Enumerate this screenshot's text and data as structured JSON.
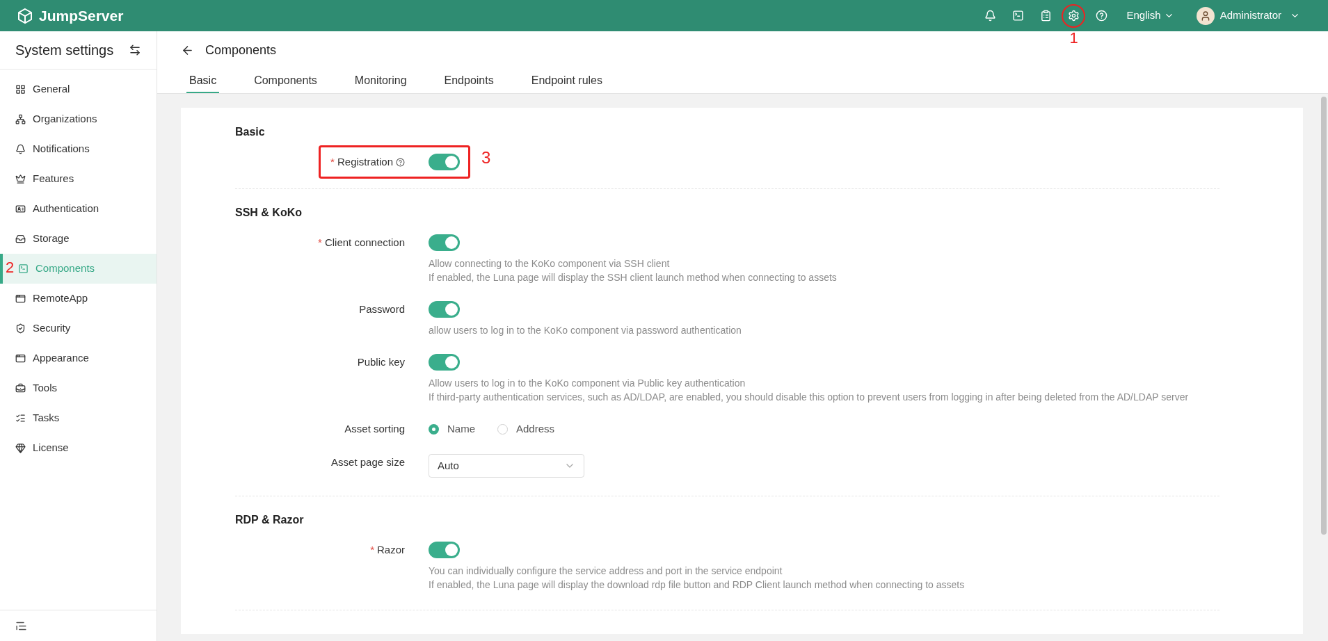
{
  "header": {
    "brand": "JumpServer",
    "icons": [
      {
        "kind": "bell"
      },
      {
        "kind": "terminal"
      },
      {
        "kind": "clipboard"
      },
      {
        "kind": "settings",
        "annotation": "1"
      },
      {
        "kind": "help"
      }
    ],
    "language": "English",
    "user": "Administrator"
  },
  "sidebar": {
    "title": "System settings",
    "items": [
      {
        "label": "General",
        "selected": false
      },
      {
        "label": "Organizations",
        "selected": false
      },
      {
        "label": "Notifications",
        "selected": false
      },
      {
        "label": "Features",
        "selected": false
      },
      {
        "label": "Authentication",
        "selected": false
      },
      {
        "label": "Storage",
        "selected": false
      },
      {
        "label": "Components",
        "selected": true,
        "annotation": "2"
      },
      {
        "label": "RemoteApp",
        "selected": false
      },
      {
        "label": "Security",
        "selected": false
      },
      {
        "label": "Appearance",
        "selected": false
      },
      {
        "label": "Tools",
        "selected": false
      },
      {
        "label": "Tasks",
        "selected": false
      },
      {
        "label": "License",
        "selected": false
      }
    ]
  },
  "page": {
    "title": "Components",
    "tabs": [
      {
        "label": "Basic",
        "selected": true
      },
      {
        "label": "Components",
        "selected": false
      },
      {
        "label": "Monitoring",
        "selected": false
      },
      {
        "label": "Endpoints",
        "selected": false
      },
      {
        "label": "Endpoint rules",
        "selected": false
      }
    ]
  },
  "sections": [
    {
      "title": "Basic",
      "fields": [
        {
          "kind": "switch",
          "label": "Registration",
          "required_mark": "*",
          "help": true,
          "on": true,
          "annotation": "3"
        }
      ]
    },
    {
      "title": "SSH & KoKo",
      "fields": [
        {
          "kind": "switch",
          "label": "Client connection",
          "required_mark": "*",
          "on": true,
          "descriptions": [
            "Allow connecting to the KoKo component via SSH client",
            "If enabled, the Luna page will display the SSH client launch method when connecting to assets"
          ]
        },
        {
          "kind": "switch",
          "label": "Password",
          "on": true,
          "descriptions": [
            "allow users to log in to the KoKo component via password authentication"
          ]
        },
        {
          "kind": "switch",
          "label": "Public key",
          "on": true,
          "descriptions": [
            "Allow users to log in to the KoKo component via Public key authentication",
            "If third-party authentication services, such as AD/LDAP, are enabled, you should disable this option to prevent users from logging in after being deleted from the AD/LDAP server"
          ]
        },
        {
          "kind": "radio",
          "label": "Asset sorting",
          "options": [
            {
              "label": "Name",
              "selected": true
            },
            {
              "label": "Address",
              "selected": false
            }
          ]
        },
        {
          "kind": "select",
          "label": "Asset page size",
          "value": "Auto"
        }
      ]
    },
    {
      "title": "RDP & Razor",
      "fields": [
        {
          "kind": "switch",
          "label": "Razor",
          "required_mark": "*",
          "on": true,
          "descriptions": [
            "You can individually configure the service address and port in the service endpoint",
            "If enabled, the Luna page will display the download rdp file button and RDP Client launch method when connecting to assets"
          ]
        }
      ]
    }
  ]
}
